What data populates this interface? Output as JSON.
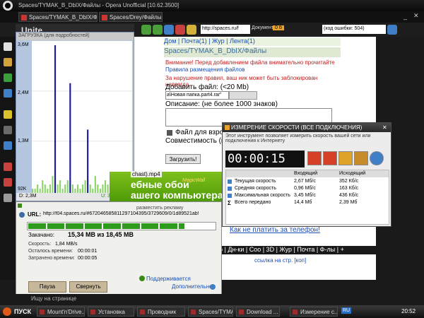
{
  "browser": {
    "title": "Spaces/TYMAK_B_DbIX/Файлы - Opera Unofficial [10.62.3500]",
    "tabs": [
      "Spaces/TYMAK_B_DbIX/Файлы",
      "Spaces/Drey/Файлы"
    ],
    "address": "http://spaces.ru/f",
    "document_label": "Документ:",
    "document_badge": "0 б",
    "error_field": "(код ошибки: 504)",
    "panel_title": "Unite"
  },
  "webpage": {
    "breadcrumb": "Spaces/TYMAK_B_DbIX/Файлы",
    "nav": "Дом | Почта(1) | Жур | Лента(1)",
    "warning_1": "Внимание! Перед добавлением файла внимательно прочитайте",
    "warning_link": "Правила размещения файлов",
    "warning_2": "За нарушение правил, ваш ник может быть заблокирован навсегда.",
    "add_file": "Добавить файл: (<20 Mb)",
    "file_value": "a\\Новая папка.part4.rar\"",
    "description": "Описание: (не более 1000 знаков)",
    "adult": "Файл для взрос...",
    "compat": "Совместимость (в...",
    "upload_button": "Загрузить!",
    "how_link": "Как не платить за телефон!",
    "bottom_nav": "р | Дн-ки | Соо | 3D | Жур | Почта | Ф-лы | +",
    "link_page": "ссылка на стр. [коп]"
  },
  "graph": {
    "title": "ЗАГРУЗКА (для подробностей)",
    "y_labels": [
      "3,6M",
      "2,4M",
      "1,3M",
      "92K"
    ],
    "download": "D: 2,3M",
    "upload": "U: 355K"
  },
  "chart_data": {
    "type": "area",
    "title": "",
    "ylabels": [
      "3,6M",
      "2,4M",
      "1,3M",
      "92K"
    ],
    "series": [
      {
        "name": "D",
        "values": [
          0.1,
          0.1,
          0.2,
          0.1,
          0.3,
          0.2,
          0.1,
          0.2,
          0.4,
          3.5,
          0.2,
          0.3,
          0.1,
          0.2,
          0.3,
          2.6,
          0.2,
          0.1,
          0.2,
          0.1,
          0.2,
          0.3,
          1.5,
          0.2,
          0.1,
          0.4,
          0.2,
          0.1,
          0.2,
          0.3,
          0.2,
          0.1,
          0.2,
          0.1,
          0.3,
          0.2,
          0.1,
          0.2,
          0.1,
          0.2
        ]
      }
    ]
  },
  "download_window": {
    "filename": "chast).mp4",
    "ad_brand": "MagicWall",
    "ad_text_1": "ебные обои",
    "ad_text_2": "ашего компьютера!",
    "hide_ad": "разместить рекламу",
    "url_label": "URL:",
    "url": "http://f04.spaces.ru/#672046585811297104395/3729609/0/1d89521ab!",
    "downloaded_label": "Закачано:",
    "downloaded_value": "15,34 MB из 18,45 MB",
    "speed_label": "Скорость:",
    "speed_value": "1,84 MB/s",
    "remaining_label": "Осталось времени:",
    "remaining_value": "00:00:01",
    "elapsed_label": "Затрачено времени:",
    "elapsed_value": "00:00:05",
    "supported": "Поддерживается",
    "more": "Дополнительно",
    "pause": "Пауза",
    "hide": "Свернуть",
    "progress": 0.83
  },
  "speed_window": {
    "title": "ИЗМЕРЕНИЕ СКОРОСТИ (ВСЕ ПОДКЛЮЧЕНИЯ)",
    "description": "Этот инструмент позволяет измерить скорость вашей сети или подключения к Интернету",
    "timer": "00:00:15",
    "col_in": "Входящий",
    "col_out": "Исходящий",
    "rows": [
      {
        "label": "Текущая скорость",
        "in": "2,67 Мб/с",
        "out": "352 Кб/с"
      },
      {
        "label": "Средняя скорость",
        "in": "0,96 Мб/с",
        "out": "163 Кб/с"
      },
      {
        "label": "Максимальная скорость",
        "in": "3,45 Мб/с",
        "out": "436 Кб/с"
      },
      {
        "label": "Всего передано",
        "in": "14,4 Мб",
        "out": "2,39 Мб"
      }
    ]
  },
  "taskbar": {
    "start": "ПУСК",
    "items": [
      "Mount'n'Drive...",
      "Установка",
      "Проводник",
      "Spaces/TYMA...",
      "Download ...",
      "Измерение с..."
    ],
    "lang": "RU",
    "clock": "20:52",
    "status": "Ищу на странице"
  }
}
